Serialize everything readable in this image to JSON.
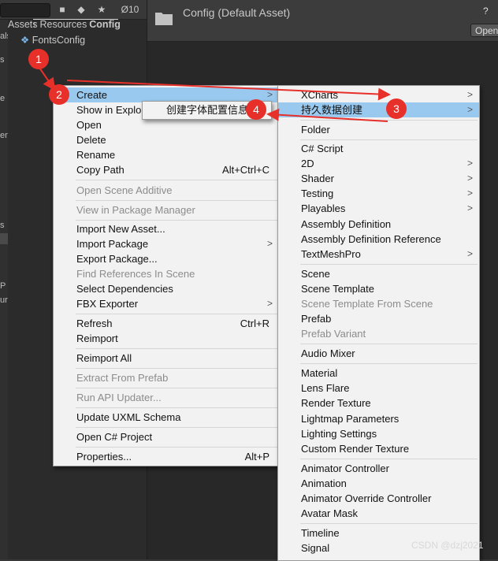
{
  "toolbar": {
    "hidden_count": "10"
  },
  "breadcrumb": [
    "Assets",
    "Resources",
    "Config"
  ],
  "project": {
    "asset_name": "FontsConfig"
  },
  "left_edge_fragments": [
    "als",
    "s",
    "e",
    "en",
    "s",
    "P",
    "ur"
  ],
  "inspector": {
    "title": "Config (Default Asset)",
    "help": "?",
    "open_label": "Open"
  },
  "main_menu": {
    "items": [
      {
        "label": "Create",
        "arrow": ">",
        "state": "highlighted"
      },
      {
        "label": "Show in Explorer",
        "state": "normal"
      },
      {
        "label": "Open",
        "state": "normal"
      },
      {
        "label": "Delete",
        "state": "normal"
      },
      {
        "label": "Rename",
        "state": "normal"
      },
      {
        "label": "Copy Path",
        "shortcut": "Alt+Ctrl+C",
        "state": "normal"
      },
      {
        "label": "Open Scene Additive",
        "state": "disabled"
      },
      {
        "label": "View in Package Manager",
        "state": "disabled"
      },
      {
        "label": "Import New Asset...",
        "state": "normal"
      },
      {
        "label": "Import Package",
        "arrow": ">",
        "state": "normal"
      },
      {
        "label": "Export Package...",
        "state": "normal"
      },
      {
        "label": "Find References In Scene",
        "state": "disabled"
      },
      {
        "label": "Select Dependencies",
        "state": "normal"
      },
      {
        "label": "FBX Exporter",
        "arrow": ">",
        "state": "normal"
      },
      {
        "label": "Refresh",
        "shortcut": "Ctrl+R",
        "state": "normal"
      },
      {
        "label": "Reimport",
        "state": "normal"
      },
      {
        "label": "Reimport All",
        "state": "normal"
      },
      {
        "label": "Extract From Prefab",
        "state": "disabled"
      },
      {
        "label": "Run API Updater...",
        "state": "disabled"
      },
      {
        "label": "Update UXML Schema",
        "state": "normal"
      },
      {
        "label": "Open C# Project",
        "state": "normal"
      },
      {
        "label": "Properties...",
        "shortcut": "Alt+P",
        "state": "normal"
      }
    ]
  },
  "create_menu": {
    "items": [
      {
        "label": "XCharts",
        "arrow": ">",
        "state": "normal"
      },
      {
        "label": "持久数据创建",
        "arrow": ">",
        "state": "highlighted"
      },
      {
        "label": "Folder",
        "state": "normal"
      },
      {
        "label": "C# Script",
        "state": "normal"
      },
      {
        "label": "2D",
        "arrow": ">",
        "state": "normal"
      },
      {
        "label": "Shader",
        "arrow": ">",
        "state": "normal"
      },
      {
        "label": "Testing",
        "arrow": ">",
        "state": "normal"
      },
      {
        "label": "Playables",
        "arrow": ">",
        "state": "normal"
      },
      {
        "label": "Assembly Definition",
        "state": "normal"
      },
      {
        "label": "Assembly Definition Reference",
        "state": "normal"
      },
      {
        "label": "TextMeshPro",
        "arrow": ">",
        "state": "normal"
      },
      {
        "label": "Scene",
        "state": "normal"
      },
      {
        "label": "Scene Template",
        "state": "normal"
      },
      {
        "label": "Scene Template From Scene",
        "state": "disabled"
      },
      {
        "label": "Prefab",
        "state": "normal"
      },
      {
        "label": "Prefab Variant",
        "state": "disabled"
      },
      {
        "label": "Audio Mixer",
        "state": "normal"
      },
      {
        "label": "Material",
        "state": "normal"
      },
      {
        "label": "Lens Flare",
        "state": "normal"
      },
      {
        "label": "Render Texture",
        "state": "normal"
      },
      {
        "label": "Lightmap Parameters",
        "state": "normal"
      },
      {
        "label": "Lighting Settings",
        "state": "normal"
      },
      {
        "label": "Custom Render Texture",
        "state": "normal"
      },
      {
        "label": "Animator Controller",
        "state": "normal"
      },
      {
        "label": "Animation",
        "state": "normal"
      },
      {
        "label": "Animator Override Controller",
        "state": "normal"
      },
      {
        "label": "Avatar Mask",
        "state": "normal"
      },
      {
        "label": "Timeline",
        "state": "normal"
      },
      {
        "label": "Signal",
        "state": "normal"
      }
    ]
  },
  "custom_menu": {
    "items": [
      {
        "label": "创建字体配置信息",
        "state": "normal"
      }
    ]
  },
  "annotations": {
    "badges": [
      "1",
      "2",
      "3",
      "4"
    ],
    "color": "#e8302a"
  },
  "watermark": "CSDN @dzj2021",
  "colors": {
    "menu_bg": "#f2f2f2",
    "menu_highlight": "#99c9ef",
    "editor_bg": "#282828"
  }
}
